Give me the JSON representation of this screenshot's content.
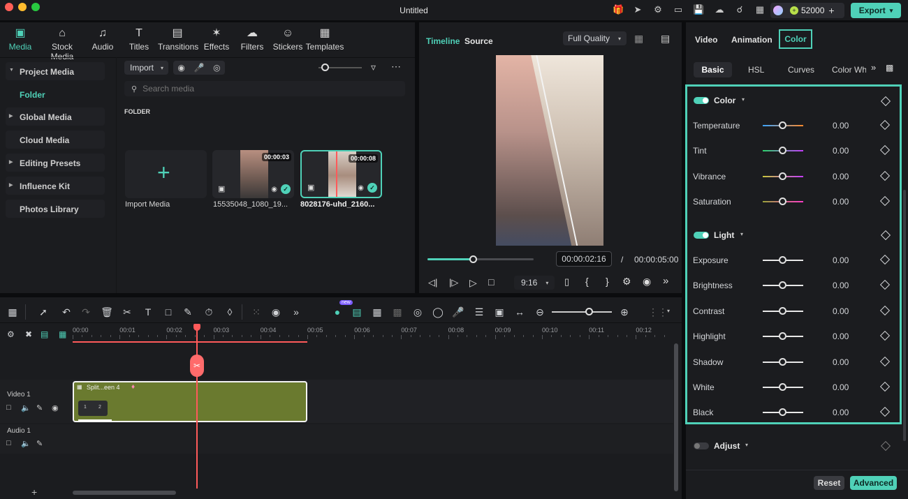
{
  "app": {
    "title": "Untitled",
    "credits": "52000",
    "export_label": "Export"
  },
  "colors": {
    "accent": "#4fd1b8",
    "playhead": "#ff5a5a",
    "clip": "#6a7a2f"
  },
  "media_tabs": [
    {
      "label": "Media",
      "icon": "media-icon"
    },
    {
      "label": "Stock Media",
      "icon": "stock-media-icon"
    },
    {
      "label": "Audio",
      "icon": "audio-icon"
    },
    {
      "label": "Titles",
      "icon": "titles-icon"
    },
    {
      "label": "Transitions",
      "icon": "transitions-icon"
    },
    {
      "label": "Effects",
      "icon": "effects-icon"
    },
    {
      "label": "Filters",
      "icon": "filters-icon"
    },
    {
      "label": "Stickers",
      "icon": "stickers-icon"
    },
    {
      "label": "Templates",
      "icon": "templates-icon"
    }
  ],
  "sidebar": {
    "project_media": "Project Media",
    "folder": "Folder",
    "global_media": "Global Media",
    "cloud_media": "Cloud Media",
    "editing_presets": "Editing Presets",
    "influence_kit": "Influence Kit",
    "photos_library": "Photos Library"
  },
  "media_toolbar": {
    "import_label": "Import",
    "search_placeholder": "Search media",
    "folder_heading": "FOLDER"
  },
  "media_items": [
    {
      "label": "Import Media"
    },
    {
      "label": "15535048_1080_19...",
      "duration": "00:00:03"
    },
    {
      "label": "8028176-uhd_2160...",
      "duration": "00:00:08"
    }
  ],
  "preview": {
    "tab_timeline": "Timeline",
    "tab_source": "Source",
    "quality": "Full Quality",
    "current_time": "00:00:02:16",
    "separator": "/",
    "total_time": "00:00:05:00",
    "aspect": "9:16",
    "progress": 0.43
  },
  "timeline": {
    "ruler": [
      "00:00",
      "00:01",
      "00:02",
      "00:03",
      "00:04",
      "00:05",
      "00:06",
      "00:07",
      "00:08",
      "00:09",
      "00:10",
      "00:11",
      "00:12"
    ],
    "video_track": "Video 1",
    "audio_track": "Audio 1",
    "clip_label": "Split...een 4",
    "clip_markers": [
      "1",
      "2"
    ],
    "new_badge": "new",
    "add_track": "+"
  },
  "props": {
    "tabs": [
      "Video",
      "Animation",
      "Color"
    ],
    "subtabs": [
      "Basic",
      "HSL",
      "Curves",
      "Color Whe"
    ],
    "color_section": "Color",
    "light_section": "Light",
    "adjust_section": "Adjust",
    "color_rows": [
      {
        "name": "Temperature",
        "value": "0.00"
      },
      {
        "name": "Tint",
        "value": "0.00"
      },
      {
        "name": "Vibrance",
        "value": "0.00"
      },
      {
        "name": "Saturation",
        "value": "0.00"
      }
    ],
    "light_rows": [
      {
        "name": "Exposure",
        "value": "0.00"
      },
      {
        "name": "Brightness",
        "value": "0.00"
      },
      {
        "name": "Contrast",
        "value": "0.00"
      },
      {
        "name": "Highlight",
        "value": "0.00"
      },
      {
        "name": "Shadow",
        "value": "0.00"
      },
      {
        "name": "White",
        "value": "0.00"
      },
      {
        "name": "Black",
        "value": "0.00"
      }
    ],
    "reset_label": "Reset",
    "advanced_label": "Advanced"
  }
}
